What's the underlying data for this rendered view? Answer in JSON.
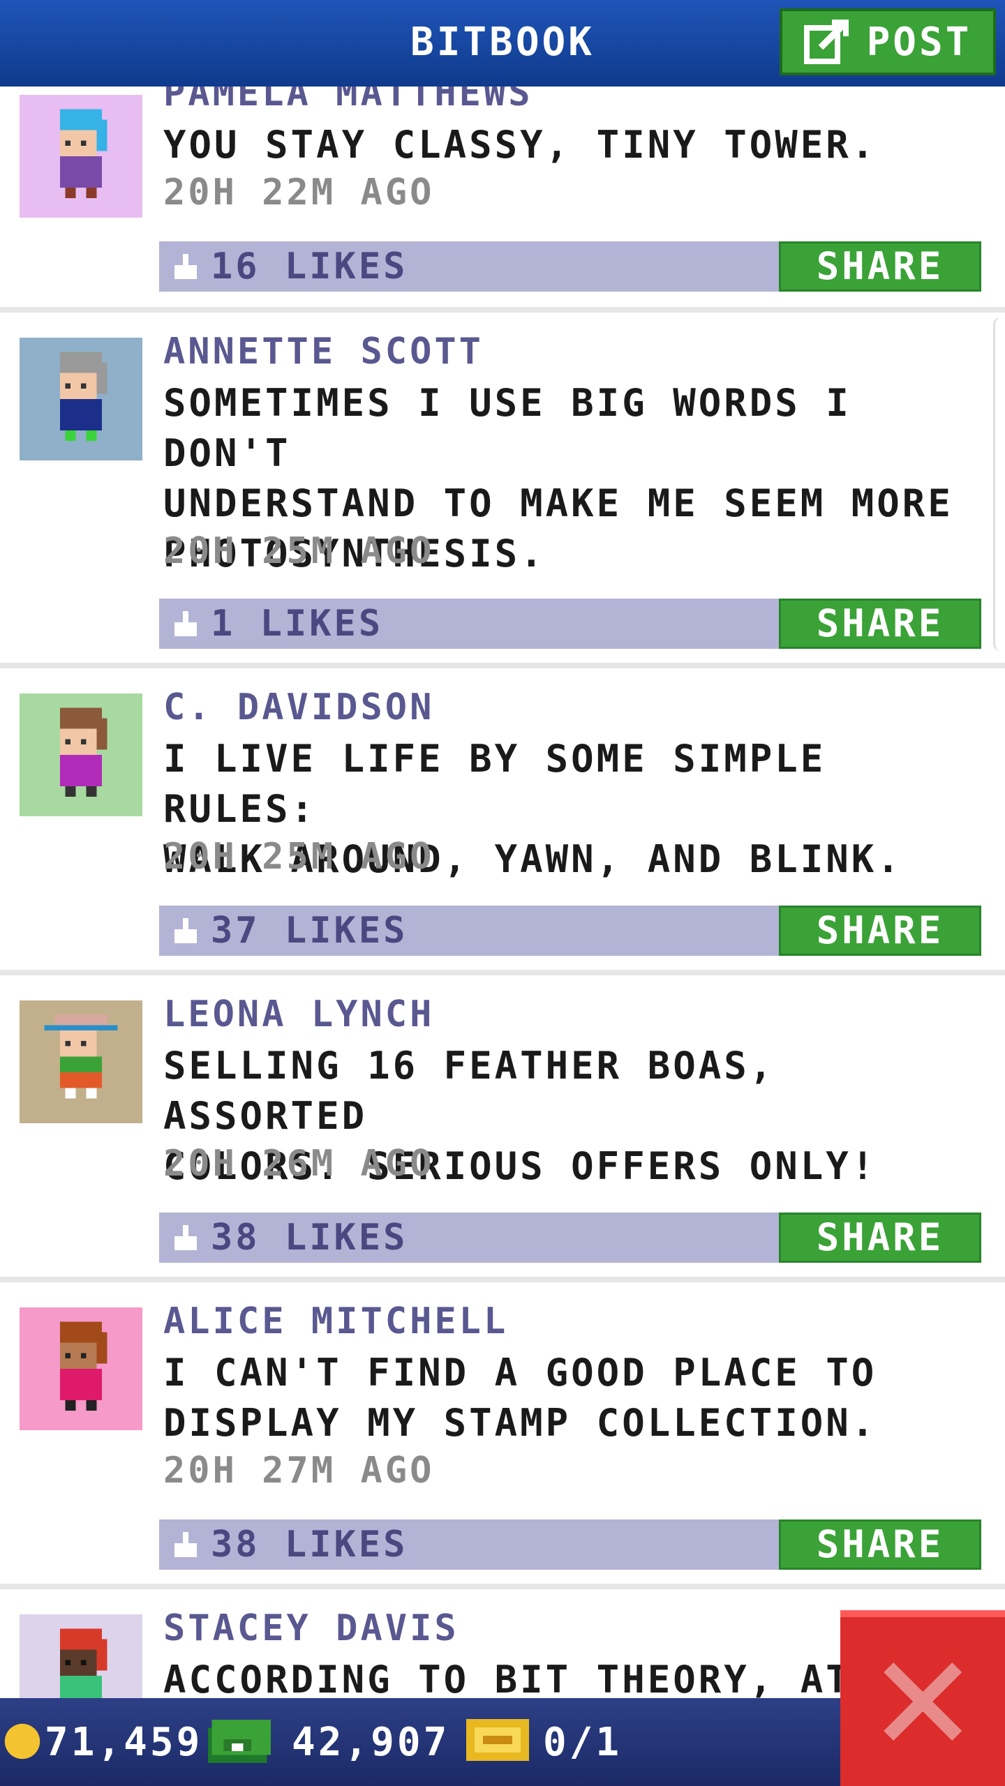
{
  "header": {
    "title": "BITBOOK",
    "post_label": "POST"
  },
  "posts": [
    {
      "name": "PAMELA MATTHEWS",
      "lines": [
        "YOU STAY CLASSY, TINY TOWER."
      ],
      "time": "20H 22M AGO",
      "likes": "16 LIKES",
      "share": "SHARE",
      "avatar_bg": "#e8bdf2"
    },
    {
      "name": "ANNETTE SCOTT",
      "lines": [
        "SOMETIMES I USE BIG WORDS I DON'T",
        "UNDERSTAND TO MAKE ME SEEM MORE",
        "PHOTOSYNTHESIS."
      ],
      "time": "20H 25M AGO",
      "likes": "1 LIKES",
      "share": "SHARE",
      "avatar_bg": "#8fb0c8"
    },
    {
      "name": "C. DAVIDSON",
      "lines": [
        "I LIVE LIFE BY SOME SIMPLE RULES:",
        "WALK AROUND, YAWN, AND BLINK."
      ],
      "time": "20H 25M AGO",
      "likes": "37 LIKES",
      "share": "SHARE",
      "avatar_bg": "#a8d9a0"
    },
    {
      "name": "LEONA LYNCH",
      "lines": [
        "SELLING 16 FEATHER BOAS, ASSORTED",
        "COLORS. SERIOUS OFFERS ONLY!"
      ],
      "time": "20H 26M AGO",
      "likes": "38 LIKES",
      "share": "SHARE",
      "avatar_bg": "#c2b08c"
    },
    {
      "name": "ALICE MITCHELL",
      "lines": [
        "I CAN'T FIND A GOOD PLACE TO",
        "DISPLAY MY STAMP COLLECTION."
      ],
      "time": "20H 27M AGO",
      "likes": "38 LIKES",
      "share": "SHARE",
      "avatar_bg": "#f59ac9"
    },
    {
      "name": "STACEY DAVIS",
      "lines": [
        "ACCORDING TO BIT THEORY, AT T"
      ],
      "time": "",
      "likes": "",
      "share": "",
      "avatar_bg": "#ddd3ea"
    }
  ],
  "footer": {
    "coins": "71,459",
    "bux": "42,907",
    "tickets": "0/1"
  },
  "colors": {
    "header": "#1f55b8",
    "share": "#3aa236",
    "likebar": "#b3b3d6",
    "close": "#dc2c2c"
  }
}
